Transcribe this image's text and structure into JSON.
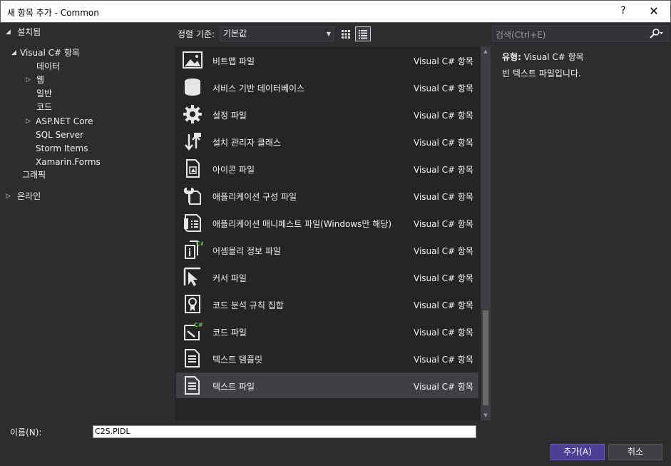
{
  "window": {
    "title": "새 항목 추가 - Common",
    "help": "?",
    "close": "✕"
  },
  "tree": {
    "installed": "설치됨",
    "visual_csharp": "Visual C# 항목",
    "data": "데이터",
    "web": "웹",
    "general": "일반",
    "code": "코드",
    "aspnet_core": "ASP.NET Core",
    "sql_server": "SQL Server",
    "storm_items": "Storm Items",
    "xamarin_forms": "Xamarin.Forms",
    "graphics": "그래픽",
    "online": "온라인"
  },
  "toolbar": {
    "sort_label": "정렬 기준:",
    "sort_value": "기본값"
  },
  "search": {
    "placeholder": "검색(Ctrl+E)"
  },
  "items": [
    {
      "name": "비트맵 파일",
      "kind": "Visual C# 항목",
      "icon": "bitmap-icon"
    },
    {
      "name": "서비스 기반 데이터베이스",
      "kind": "Visual C# 항목",
      "icon": "database-icon"
    },
    {
      "name": "설정 파일",
      "kind": "Visual C# 항목",
      "icon": "settings-gear-icon"
    },
    {
      "name": "설치 관리자 클래스",
      "kind": "Visual C# 항목",
      "icon": "installer-icon"
    },
    {
      "name": "아이콘 파일",
      "kind": "Visual C# 항목",
      "icon": "icon-file-icon"
    },
    {
      "name": "애플리케이션 구성 파일",
      "kind": "Visual C# 항목",
      "icon": "config-wrench-icon"
    },
    {
      "name": "애플리케이션 매니페스트 파일(Windows만 해당)",
      "kind": "Visual C# 항목",
      "icon": "manifest-icon"
    },
    {
      "name": "어셈블리 정보 파일",
      "kind": "Visual C# 항목",
      "icon": "assembly-info-icon"
    },
    {
      "name": "커서 파일",
      "kind": "Visual C# 항목",
      "icon": "cursor-icon"
    },
    {
      "name": "코드 분석 규칙 집합",
      "kind": "Visual C# 항목",
      "icon": "ruleset-icon"
    },
    {
      "name": "코드 파일",
      "kind": "Visual C# 항목",
      "icon": "code-file-icon"
    },
    {
      "name": "텍스트 템플릿",
      "kind": "Visual C# 항목",
      "icon": "text-template-icon"
    },
    {
      "name": "텍스트 파일",
      "kind": "Visual C# 항목",
      "icon": "text-file-icon"
    }
  ],
  "details": {
    "type_label": "유형:",
    "type_value": "Visual C# 항목",
    "description": "빈 텍스트 파일입니다."
  },
  "footer": {
    "name_label": "이름(N):",
    "name_value": "C2S.PIDL",
    "add_label": "추가(A)",
    "cancel_label": "취소"
  },
  "colors": {
    "accent": "#4d3e95",
    "background": "#2d2d30",
    "list_bg": "#252526"
  }
}
